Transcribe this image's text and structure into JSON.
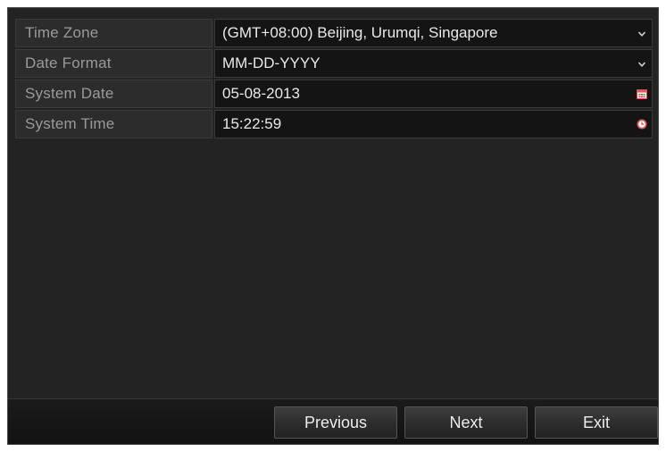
{
  "settings": {
    "time_zone": {
      "label": "Time Zone",
      "value": "(GMT+08:00) Beijing, Urumqi, Singapore",
      "icon": "chevron-down-icon"
    },
    "date_format": {
      "label": "Date Format",
      "value": "MM-DD-YYYY",
      "icon": "chevron-down-icon"
    },
    "system_date": {
      "label": "System Date",
      "value": "05-08-2013",
      "icon": "calendar-icon"
    },
    "system_time": {
      "label": "System Time",
      "value": "15:22:59",
      "icon": "clock-icon"
    }
  },
  "buttons": {
    "previous": "Previous",
    "next": "Next",
    "exit": "Exit"
  },
  "colors": {
    "panel_background": "#232323",
    "field_background": "#141414",
    "label_text": "#9a9a9a",
    "value_text": "#e8e8e8",
    "calendar_icon": "#e05a5a",
    "clock_icon": "#e05a5a"
  }
}
